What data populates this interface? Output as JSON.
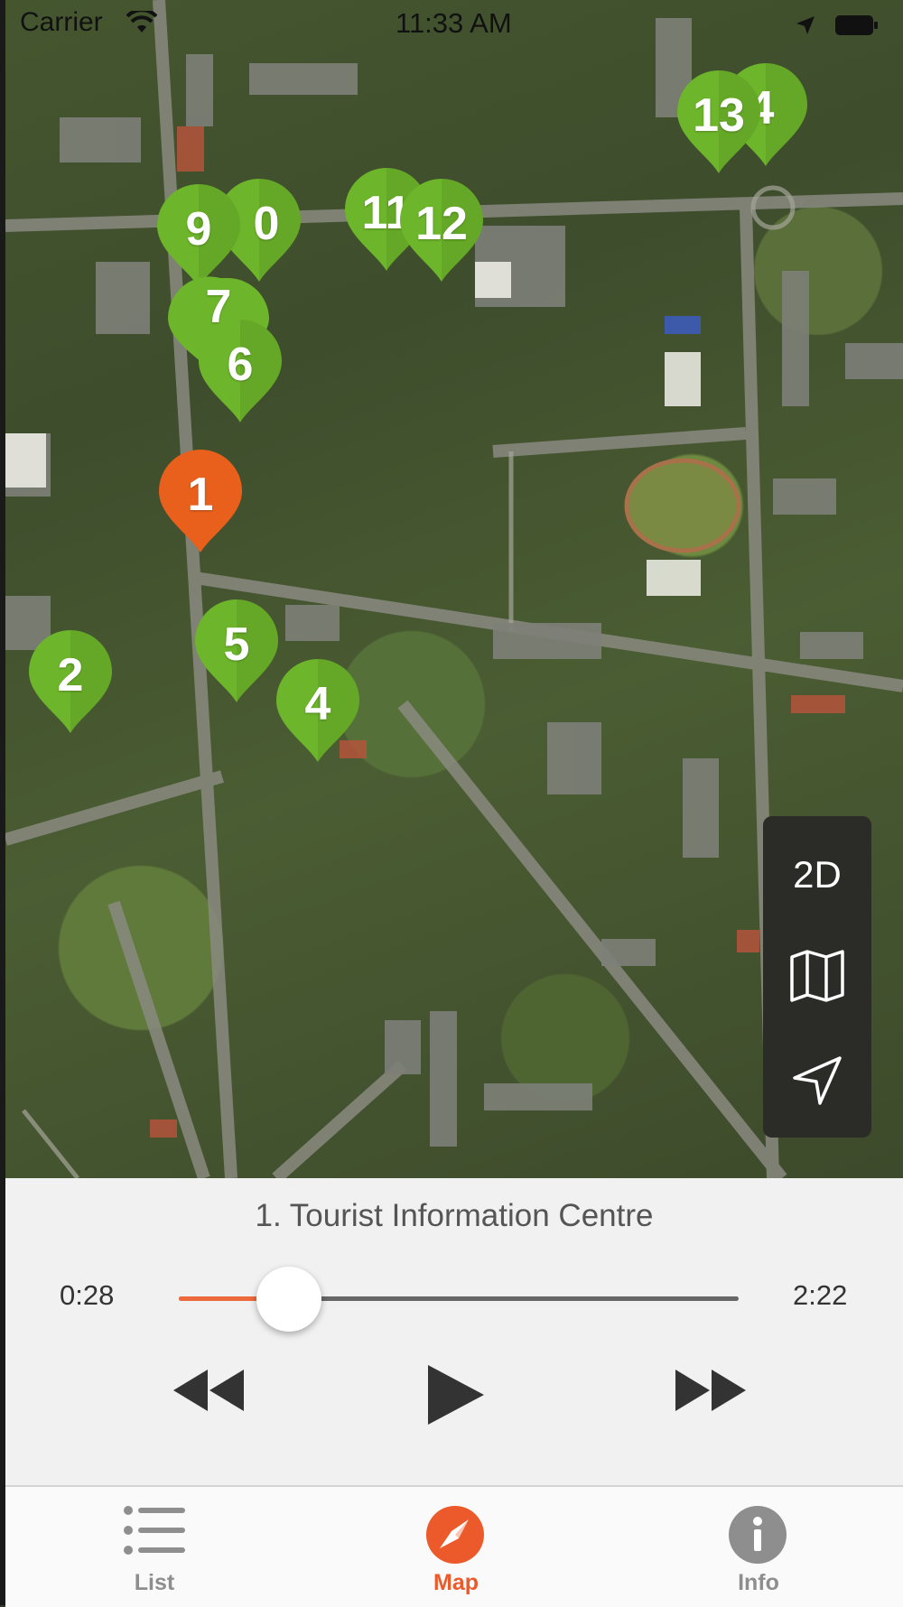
{
  "status_bar": {
    "carrier": "Carrier",
    "time": "11:33 AM"
  },
  "map": {
    "pins": [
      {
        "label": "13",
        "color": "#6db52a"
      },
      {
        "label": "4",
        "color": "#6db52a"
      },
      {
        "label": "9",
        "color": "#6db52a"
      },
      {
        "label": "0",
        "color": "#6db52a"
      },
      {
        "label": "11",
        "color": "#6db52a"
      },
      {
        "label": "12",
        "color": "#6db52a"
      },
      {
        "label": "7",
        "color": "#6db52a"
      },
      {
        "label": "6",
        "color": "#6db52a"
      },
      {
        "label": "1",
        "color": "#e8601c"
      },
      {
        "label": "5",
        "color": "#6db52a"
      },
      {
        "label": "2",
        "color": "#6db52a"
      },
      {
        "label": "4",
        "color": "#6db52a"
      }
    ],
    "controls": {
      "mode_label": "2D",
      "map_icon": "map-icon",
      "location_icon": "location-arrow-icon"
    }
  },
  "player": {
    "title": "1. Tourist Information Centre",
    "elapsed": "0:28",
    "duration": "2:22",
    "progress": 0.197,
    "accent_color": "#ec6a3c",
    "buttons": {
      "rewind_icon": "rewind-icon",
      "play_icon": "play-icon",
      "forward_icon": "fast-forward-icon"
    }
  },
  "tabbar": {
    "tabs": [
      {
        "label": "List",
        "icon": "list-icon",
        "active": false
      },
      {
        "label": "Map",
        "icon": "compass-icon",
        "active": true
      },
      {
        "label": "Info",
        "icon": "info-icon",
        "active": false
      }
    ],
    "active_color": "#ec5a2b"
  }
}
